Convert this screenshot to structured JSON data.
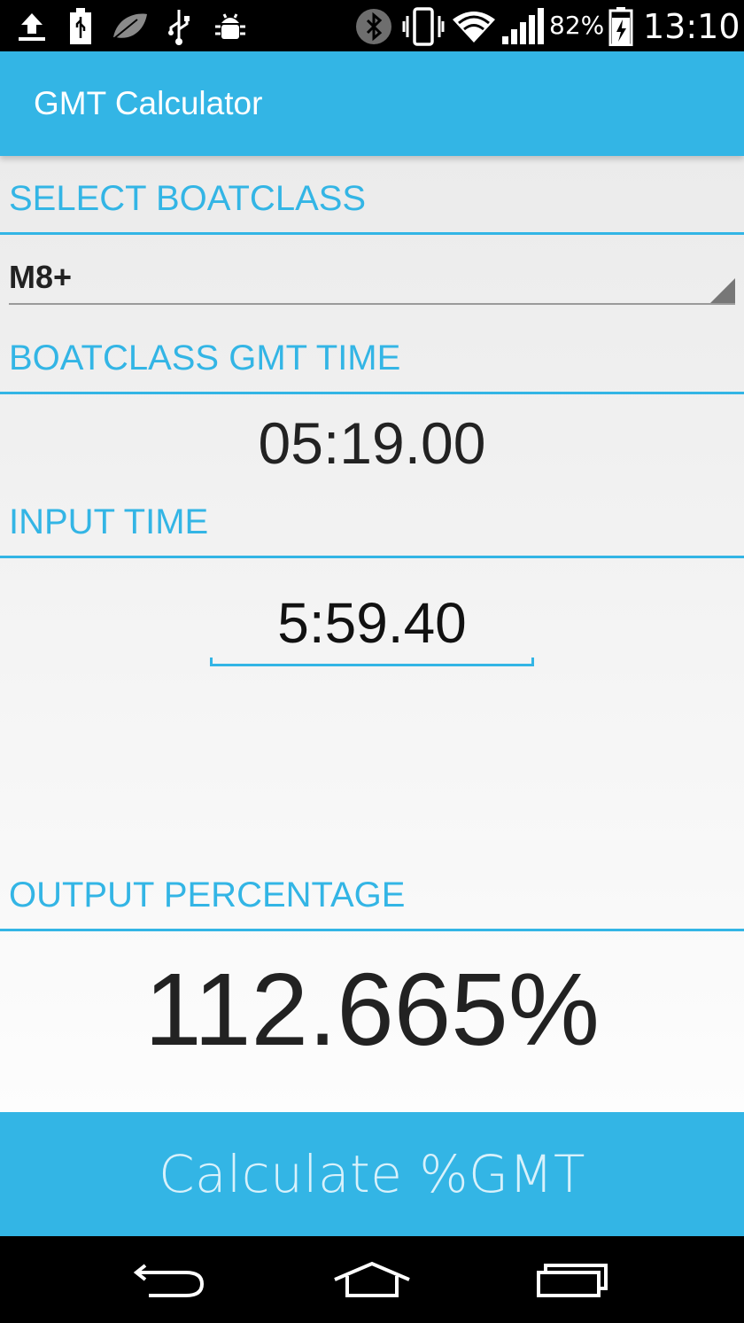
{
  "status_bar": {
    "icons": [
      "upload-icon",
      "sd-card-usb-icon",
      "leaf-icon",
      "usb-icon",
      "android-debug-icon",
      "bluetooth-icon",
      "vibrate-icon",
      "wifi-icon",
      "signal-icon",
      "battery-charging-icon"
    ],
    "battery_percent": "82%",
    "time": "13:10"
  },
  "app_bar": {
    "title": "GMT Calculator"
  },
  "select_section": {
    "header": "SELECT BOATCLASS",
    "selected_value": "M8+"
  },
  "gmt_section": {
    "header": "BOATCLASS GMT TIME",
    "value": "05:19.00"
  },
  "input_section": {
    "header": "INPUT TIME",
    "value": "5:59.40"
  },
  "output_section": {
    "header": "OUTPUT PERCENTAGE",
    "value": "112.665%"
  },
  "calculate_button": {
    "label": "Calculate %GMT"
  },
  "nav_bar": {
    "icons": [
      "back-icon",
      "home-icon",
      "recent-apps-icon"
    ]
  },
  "colors": {
    "accent": "#33b5e5",
    "button_text": "#d8f1fb",
    "background": "#f0f0f0"
  }
}
